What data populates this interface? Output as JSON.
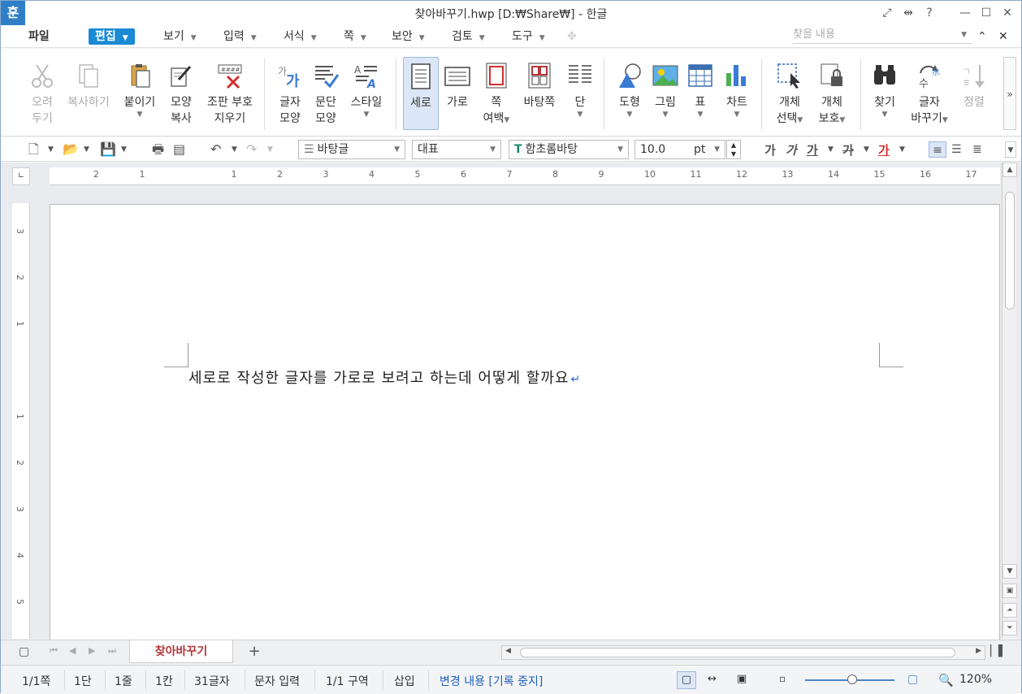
{
  "window": {
    "title": "찾아바꾸기.hwp [D:₩Share₩] - 한글",
    "app_logo": "훈"
  },
  "titlebar_buttons": [
    "⤢",
    "⇹",
    "?",
    "—",
    "☐",
    "✕"
  ],
  "menu": {
    "file": "파일",
    "items": [
      "편집",
      "보기",
      "입력",
      "서식",
      "쪽",
      "보안",
      "검토",
      "도구"
    ],
    "search_placeholder": "찾을 내용",
    "collapse": "⌃",
    "close": "✕"
  },
  "ribbon": {
    "cut": [
      "오려",
      "두기"
    ],
    "copy": "복사하기",
    "paste": "붙이기",
    "format_copy": [
      "모양",
      "복사"
    ],
    "clear_marks": [
      "조판 부호",
      "지우기"
    ],
    "char_shape": [
      "글자",
      "모양"
    ],
    "para_shape": [
      "문단",
      "모양"
    ],
    "style": "스타일",
    "vertical": "세로",
    "horizontal": "가로",
    "page_margin": [
      "쪽",
      "여백"
    ],
    "master_page": "바탕쪽",
    "column": "단",
    "shape": "도형",
    "picture": "그림",
    "table": "표",
    "chart": "차트",
    "obj_select": [
      "개체",
      "선택"
    ],
    "obj_protect": [
      "개체",
      "보호"
    ],
    "find": "찾기",
    "replace": [
      "글자",
      "바꾸기"
    ],
    "sort": "정렬",
    "more": "»"
  },
  "toolbar": {
    "style_name": "바탕글",
    "lang": "대표",
    "font": "함초롬바탕",
    "font_size": "10.0",
    "unit": "pt",
    "format_glyphs": [
      "가",
      "가",
      "가",
      "가",
      "가"
    ]
  },
  "ruler": {
    "h_numbers": [
      "2",
      "1",
      "",
      "1",
      "2",
      "3",
      "4",
      "5",
      "6",
      "7",
      "8",
      "9",
      "10",
      "11",
      "12",
      "13",
      "14",
      "15",
      "16",
      "17"
    ],
    "v_numbers": [
      "3",
      "2",
      "1",
      "",
      "1",
      "2",
      "3",
      "4",
      "5"
    ]
  },
  "document": {
    "text": "세로로 작성한 글자를 가로로 보려고 하는데 어떻게 할까요",
    "para_mark": "↵"
  },
  "tabs": {
    "active": "찾아바꾸기",
    "add": "+"
  },
  "status": {
    "page": "1/1쪽",
    "column": "1단",
    "line": "1줄",
    "char_pos": "1칸",
    "count": "31글자",
    "mode": "문자 입력",
    "section": "1/1 구역",
    "insert": "삽입",
    "track": "변경 내용 [기록 중지]",
    "zoom": "120%"
  },
  "colors": {
    "accent": "#1a8ad4",
    "tab_text": "#b4363a",
    "track_text": "#1d5fbd"
  }
}
